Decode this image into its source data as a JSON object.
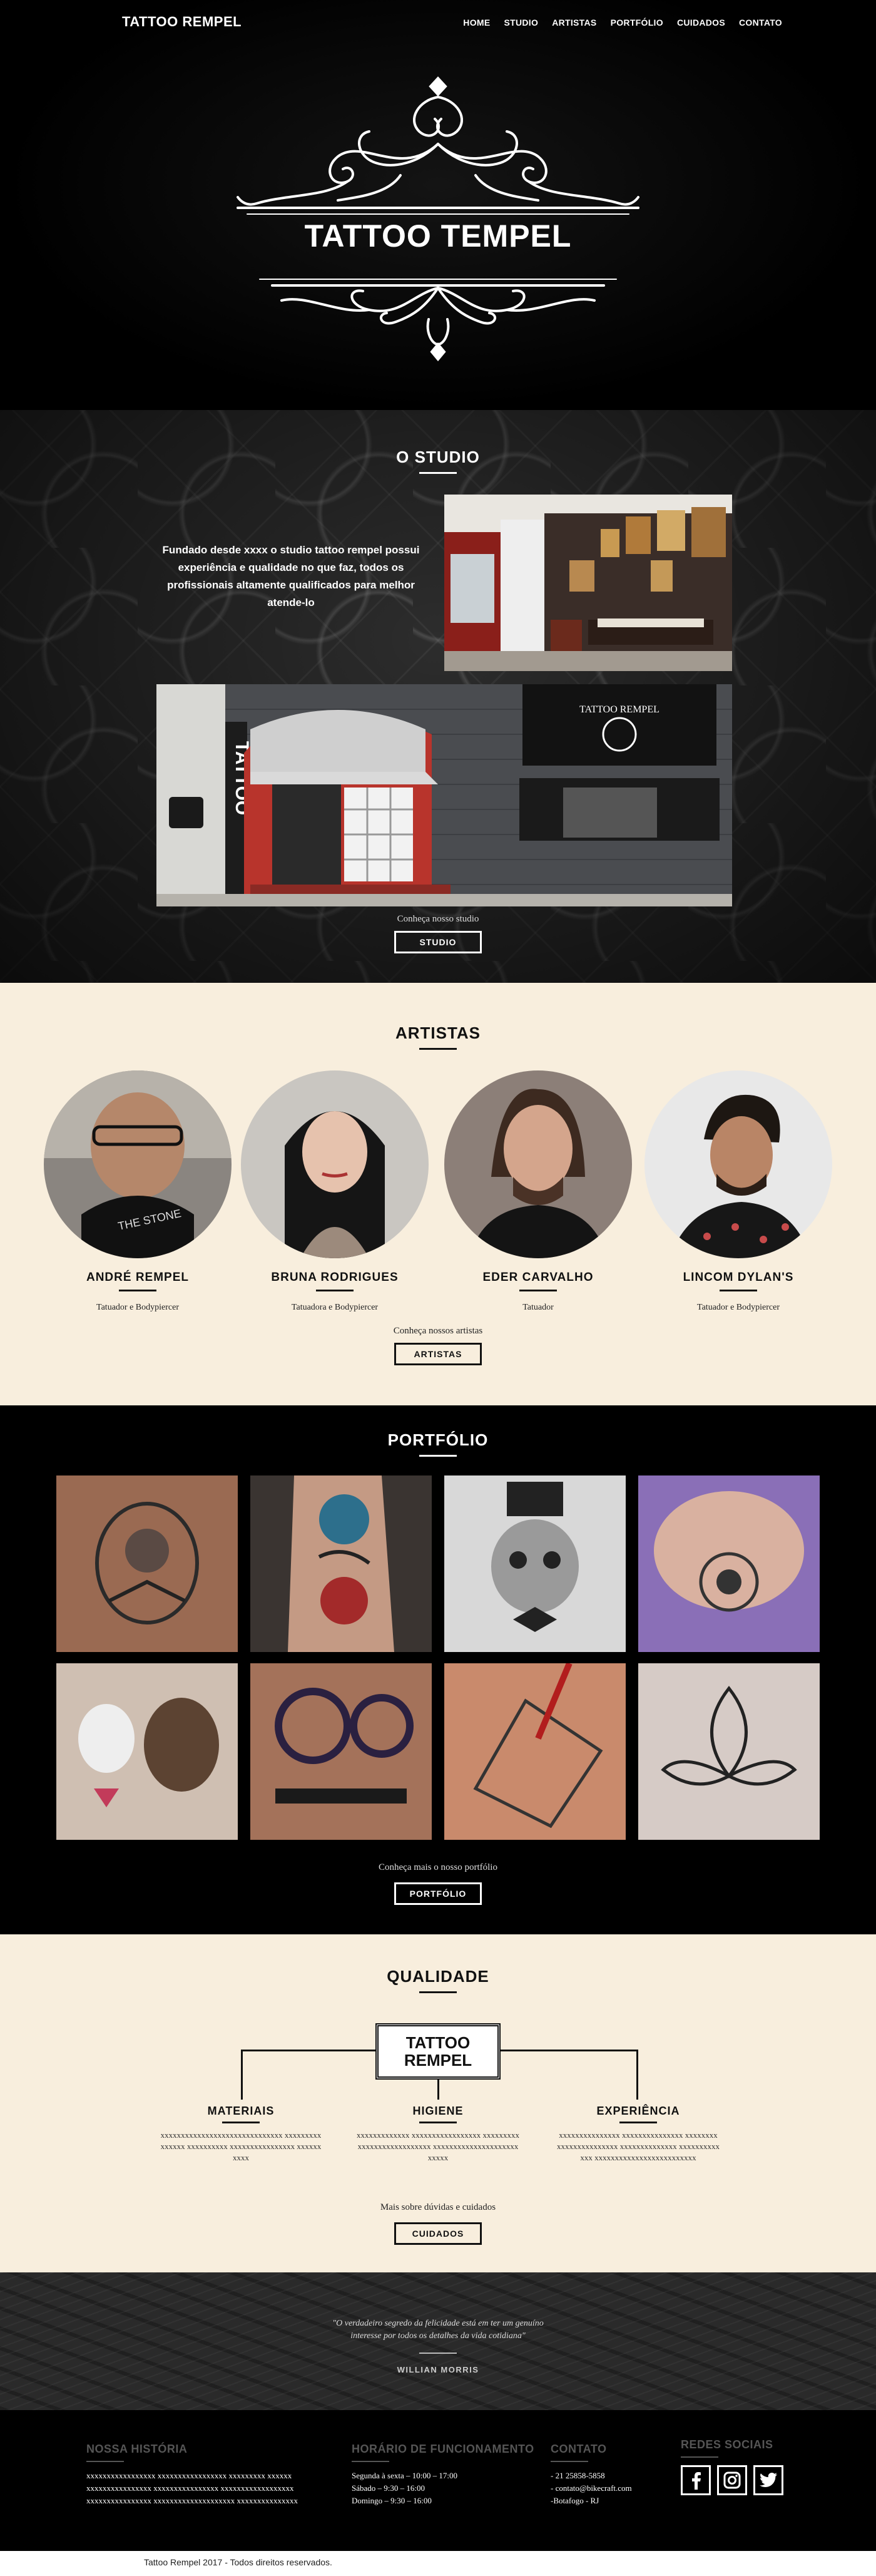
{
  "brand": "TATTOO REMPEL",
  "nav": [
    "HOME",
    "STUDIO",
    "ARTISTAS",
    "PORTFÓLIO",
    "CUIDADOS",
    "CONTATO"
  ],
  "hero": {
    "title": "TATTOO TEMPEL"
  },
  "studio": {
    "title": "O STUDIO",
    "text": "Fundado desde xxxx o studio tattoo rempel possui experiência e qualidade no que faz, todos os profissionais altamente qualificados para melhor atende-lo",
    "sign_text": "TATTOO",
    "awning_text": "TATTOO REMPEL",
    "cta": "Conheça nosso studio",
    "button": "STUDIO"
  },
  "artistas": {
    "title": "ARTISTAS",
    "items": [
      {
        "name": "ANDRÉ REMPEL",
        "role": "Tatuador e Bodypiercer"
      },
      {
        "name": "BRUNA RODRIGUES",
        "role": "Tatuadora e Bodypiercer"
      },
      {
        "name": "EDER CARVALHO",
        "role": "Tatuador"
      },
      {
        "name": "LINCOM DYLAN'S",
        "role": "Tatuador e Bodypiercer"
      }
    ],
    "cta": "Conheça nossos artistas",
    "button": "ARTISTAS"
  },
  "portfolio": {
    "title": "PORTFÓLIO",
    "cta": "Conheça mais o nosso portfólio",
    "button": "PORTFÓLIO"
  },
  "qualidade": {
    "title": "QUALIDADE",
    "box_line1": "TATTOO",
    "box_line2": "REMPEL",
    "items": [
      {
        "title": "MATERIAIS",
        "desc": "xxxxxxxxxxxxxxxxxxxxxxxxxxxxxx xxxxxxxxxxxxxxx xxxxxxxxxx xxxxxxxxxxxxxxxx xxxxxxxxxx"
      },
      {
        "title": "HIGIENE",
        "desc": "xxxxxxxxxxxxx xxxxxxxxxxxxxxxxx xxxxxxxxxxxxxxxxxxxxxxxxxxx xxxxxxxxxxxxxxxxxxxxxxxxxx"
      },
      {
        "title": "EXPERIÊNCIA",
        "desc": "xxxxxxxxxxxxxxx xxxxxxxxxxxxxxx xxxxxxxx xxxxxxxxxxxxxxx xxxxxxxxxxxxxx xxxxxxxxxxxxx xxxxxxxxxxxxxxxxxxxxxxxxx"
      }
    ],
    "cta": "Mais sobre dúvidas e cuidados",
    "button": "CUIDADOS"
  },
  "quote": {
    "line1": "\"O verdadeiro segredo da felicidade está em ter um genuíno",
    "line2": "interesse por todos os detalhes da vida cotidiana\"",
    "author": "WILLIAN MORRIS"
  },
  "footer": {
    "historia": {
      "title": "NOSSA HISTÓRIA",
      "lines": [
        "xxxxxxxxxxxxxxxxx xxxxxxxxxxxxxxxxx xxxxxxxxx xxxxxx",
        "xxxxxxxxxxxxxxxx xxxxxxxxxxxxxxxx xxxxxxxxxxxxxxxxxx",
        "xxxxxxxxxxxxxxxx xxxxxxxxxxxxxxxxxxxx xxxxxxxxxxxxxxx"
      ]
    },
    "horario": {
      "title": "HORÁRIO DE FUNCIONAMENTO",
      "lines": [
        "Segunda à sexta – 10:00 – 17:00",
        "Sábado – 9:30 – 16:00",
        "Domingo – 9:30 – 16:00"
      ]
    },
    "contato": {
      "title": "CONTATO",
      "lines": [
        "- 21 25858-5858",
        "- contato@bikecraft.com",
        "-Botafogo - RJ"
      ]
    },
    "redes": {
      "title": "REDES SOCIAIS",
      "icons": [
        "facebook-icon",
        "instagram-icon",
        "twitter-icon"
      ]
    }
  },
  "copyright": "Tattoo Rempel  2017 - Todos direitos reservados."
}
